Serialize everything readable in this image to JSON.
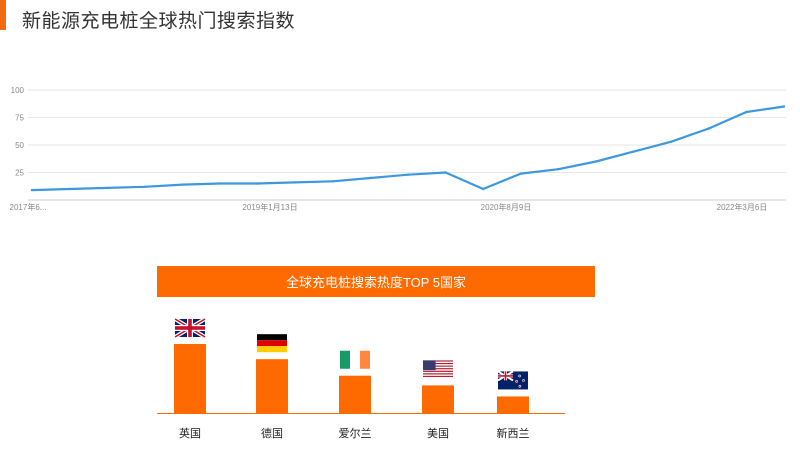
{
  "page": {
    "title": "新能源充电桩全球热门搜索指数"
  },
  "chart_data": [
    {
      "type": "line",
      "title": "",
      "xlabel": "",
      "ylabel": "",
      "ylim": [
        0,
        100
      ],
      "y_ticks": [
        "25",
        "50",
        "75",
        "100"
      ],
      "x_ticks": [
        "2017年6...",
        "2019年1月13日",
        "2020年8月9日",
        "2022年3月6日"
      ],
      "grid": true,
      "color": "#3d98dd",
      "x": [
        "2017-06",
        "2017-09",
        "2017-12",
        "2018-03",
        "2018-06",
        "2018-09",
        "2018-12",
        "2019-03",
        "2019-06",
        "2019-09",
        "2019-12",
        "2020-03",
        "2020-06",
        "2020-09",
        "2020-12",
        "2021-03",
        "2021-06",
        "2021-09",
        "2021-12",
        "2022-02",
        "2022-04"
      ],
      "values": [
        9,
        10,
        11,
        12,
        14,
        15,
        15,
        16,
        17,
        20,
        23,
        25,
        10,
        24,
        28,
        35,
        44,
        53,
        65,
        80,
        85
      ]
    },
    {
      "type": "bar",
      "title": "全球充电桩搜索热度TOP 5国家",
      "categories": [
        "英国",
        "德国",
        "爱尔兰",
        "美国",
        "新西兰"
      ],
      "values": [
        100,
        78,
        54,
        40,
        24
      ],
      "color": "#ff6a00",
      "flags": [
        "uk-flag-icon",
        "germany-flag-icon",
        "ireland-flag-icon",
        "usa-flag-icon",
        "new-zealand-flag-icon"
      ]
    }
  ]
}
